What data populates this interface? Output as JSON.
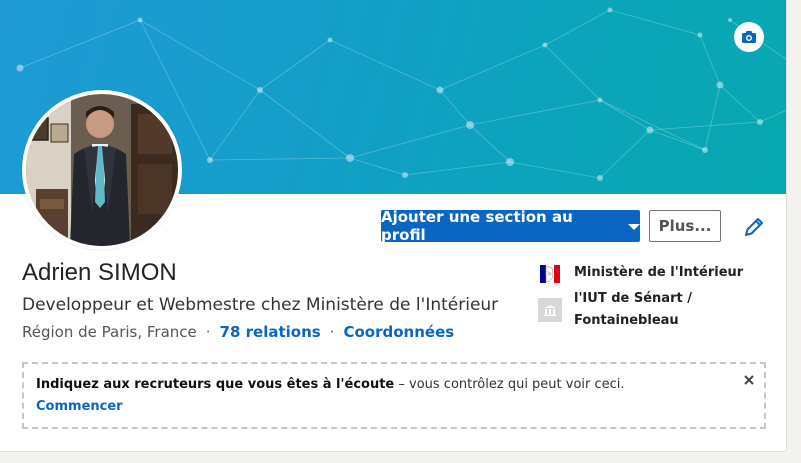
{
  "profile": {
    "name": "Adrien SIMON",
    "headline": "Developpeur et Webmestre chez Ministère de l'Intérieur",
    "location": "Région de Paris, France",
    "separator": "·",
    "relations": "78 relations",
    "contact_info": "Coordonnées"
  },
  "actions": {
    "add_section": "Ajouter une section au profil",
    "more": "Plus...",
    "edit_icon": "pencil-icon",
    "camera_icon": "camera-icon"
  },
  "orgs": [
    {
      "name": "Ministère de l'Intérieur",
      "icon": "marianne-logo"
    },
    {
      "name": "l'IUT de Sénart / Fontainebleau",
      "icon": "school-building-icon"
    }
  ],
  "open_to_work": {
    "bold_text": "Indiquez aux recruteurs que vous êtes à l'écoute",
    "rest_text": " – vous contrôlez qui peut voir ceci.",
    "link": "Commencer",
    "close_icon": "close-icon"
  },
  "colors": {
    "accent": "#0a66c2",
    "banner_start": "#1f9ad6",
    "banner_end": "#08a8b0"
  }
}
